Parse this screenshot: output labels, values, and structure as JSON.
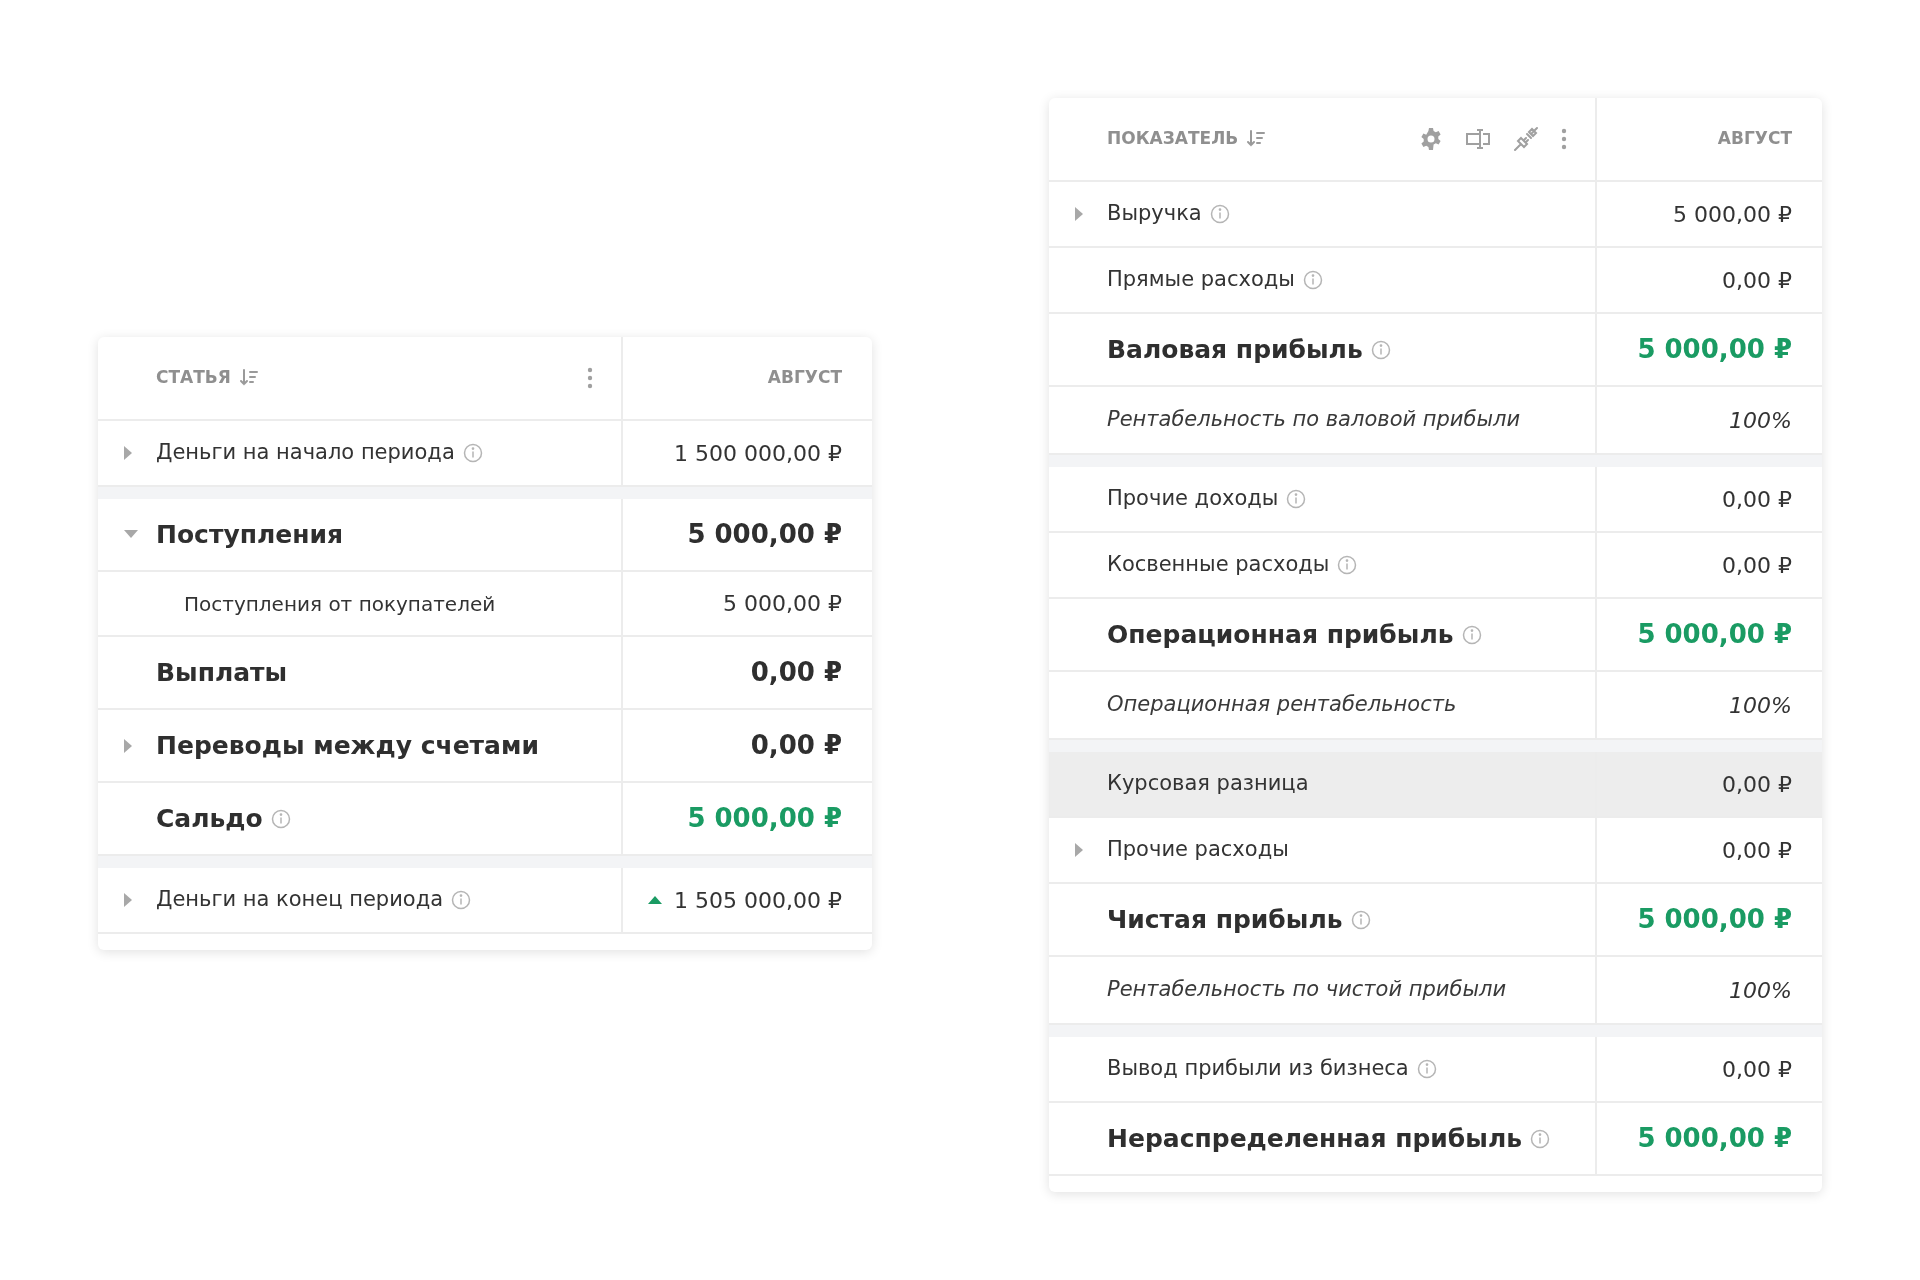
{
  "tables": [
    {
      "header": {
        "label": "СТАТЬЯ",
        "column": "АВГУСТ",
        "tools": false
      },
      "rows": [
        {
          "label": "Деньги на начало периода",
          "value": "1 500 000,00 ₽",
          "kind": "normal",
          "info": true,
          "expanded": false,
          "accented": false,
          "trend_up": false,
          "group_start": false,
          "highlighted": false
        },
        {
          "label": "Поступления",
          "value": "5 000,00 ₽",
          "kind": "bold",
          "info": false,
          "expanded": true,
          "accented": false,
          "trend_up": false,
          "group_start": true,
          "highlighted": false
        },
        {
          "label": "Поступления от покупателей",
          "value": "5 000,00 ₽",
          "kind": "child",
          "info": false,
          "accented": false,
          "trend_up": false,
          "group_start": false,
          "highlighted": false
        },
        {
          "label": "Выплаты",
          "value": "0,00 ₽",
          "kind": "bold",
          "info": false,
          "accented": false,
          "trend_up": false,
          "group_start": false,
          "highlighted": false
        },
        {
          "label": "Переводы между счетами",
          "value": "0,00 ₽",
          "kind": "bold",
          "info": false,
          "expanded": false,
          "accented": false,
          "trend_up": false,
          "group_start": false,
          "highlighted": false
        },
        {
          "label": "Сальдо",
          "value": "5 000,00 ₽",
          "kind": "bold",
          "info": true,
          "accented": true,
          "trend_up": false,
          "group_start": false,
          "highlighted": false
        },
        {
          "label": "Деньги на конец периода",
          "value": "1 505 000,00 ₽",
          "kind": "normal",
          "info": true,
          "expanded": false,
          "accented": false,
          "trend_up": true,
          "group_start": true,
          "highlighted": false
        }
      ]
    },
    {
      "header": {
        "label": "ПОКАЗАТЕЛЬ",
        "column": "АВГУСТ",
        "tools": true
      },
      "rows": [
        {
          "label": "Выручка",
          "value": "5 000,00 ₽",
          "kind": "normal",
          "info": true,
          "expanded": false,
          "accented": false,
          "trend_up": false,
          "group_start": false,
          "highlighted": false
        },
        {
          "label": "Прямые расходы",
          "value": "0,00 ₽",
          "kind": "normal",
          "info": true,
          "accented": false,
          "trend_up": false,
          "group_start": false,
          "highlighted": false
        },
        {
          "label": "Валовая прибыль",
          "value": "5 000,00 ₽",
          "kind": "bold",
          "info": true,
          "accented": true,
          "trend_up": false,
          "group_start": false,
          "highlighted": false
        },
        {
          "label": "Рентабельность по валовой прибыли",
          "value": "100%",
          "kind": "italic",
          "info": false,
          "accented": false,
          "trend_up": false,
          "group_start": false,
          "highlighted": false
        },
        {
          "label": "Прочие доходы",
          "value": "0,00 ₽",
          "kind": "normal",
          "info": true,
          "accented": false,
          "trend_up": false,
          "group_start": true,
          "highlighted": false
        },
        {
          "label": "Косвенные расходы",
          "value": "0,00 ₽",
          "kind": "normal",
          "info": true,
          "accented": false,
          "trend_up": false,
          "group_start": false,
          "highlighted": false
        },
        {
          "label": "Операционная прибыль",
          "value": "5 000,00 ₽",
          "kind": "bold",
          "info": true,
          "accented": true,
          "trend_up": false,
          "group_start": false,
          "highlighted": false
        },
        {
          "label": "Операционная рентабельность",
          "value": "100%",
          "kind": "italic",
          "info": false,
          "accented": false,
          "trend_up": false,
          "group_start": false,
          "highlighted": false
        },
        {
          "label": "Курсовая разница",
          "value": "0,00 ₽",
          "kind": "normal",
          "info": false,
          "accented": false,
          "trend_up": false,
          "group_start": true,
          "highlighted": true
        },
        {
          "label": "Прочие расходы",
          "value": "0,00 ₽",
          "kind": "normal",
          "info": false,
          "expanded": false,
          "accented": false,
          "trend_up": false,
          "group_start": false,
          "highlighted": false
        },
        {
          "label": "Чистая прибыль",
          "value": "5 000,00 ₽",
          "kind": "bold",
          "info": true,
          "accented": true,
          "trend_up": false,
          "group_start": false,
          "highlighted": false
        },
        {
          "label": "Рентабельность по чистой прибыли",
          "value": "100%",
          "kind": "italic",
          "info": false,
          "accented": false,
          "trend_up": false,
          "group_start": false,
          "highlighted": false
        },
        {
          "label": "Вывод прибыли из бизнеса",
          "value": "0,00 ₽",
          "kind": "normal",
          "info": true,
          "accented": false,
          "trend_up": false,
          "group_start": true,
          "highlighted": false
        },
        {
          "label": "Нераспределенная прибыль",
          "value": "5 000,00 ₽",
          "kind": "bold",
          "info": true,
          "accented": true,
          "trend_up": false,
          "group_start": false,
          "highlighted": false
        }
      ]
    }
  ]
}
